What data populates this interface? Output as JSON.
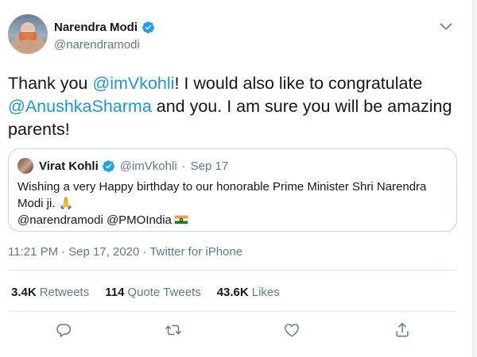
{
  "author": {
    "name": "Narendra Modi",
    "handle": "@narendramodi"
  },
  "tweet": {
    "text_parts": [
      {
        "text": "Thank you ",
        "mention": false
      },
      {
        "text": "@imVkohli",
        "mention": true
      },
      {
        "text": "! I would also like to congratulate ",
        "mention": false
      },
      {
        "text": "@AnushkaSharma",
        "mention": true
      },
      {
        "text": " and you. I am sure you will be amazing parents!",
        "mention": false
      }
    ]
  },
  "quote": {
    "name": "Virat Kohli",
    "handle": "@imVkohli",
    "separator": "·",
    "date": "Sep 17",
    "text_line1": "Wishing a very Happy birthday to our honorable Prime Minister Shri Narendra Modi ji. 🙏",
    "text_line2": "@narendramodi @PMOIndia"
  },
  "meta": {
    "time": "11:21 PM",
    "date": "Sep 17, 2020",
    "source": "Twitter for iPhone",
    "dot": "·"
  },
  "stats": {
    "retweets_count": "3.4K",
    "retweets_label": "Retweets",
    "quotes_count": "114",
    "quotes_label": "Quote Tweets",
    "likes_count": "43.6K",
    "likes_label": "Likes"
  },
  "colors": {
    "accent": "#1da1f2",
    "mention": "#1b95e0",
    "muted": "#657786"
  },
  "icons": [
    "verified-badge-icon",
    "chevron-down-icon",
    "reply-icon",
    "retweet-icon",
    "like-icon",
    "share-icon",
    "india-flag-icon"
  ]
}
